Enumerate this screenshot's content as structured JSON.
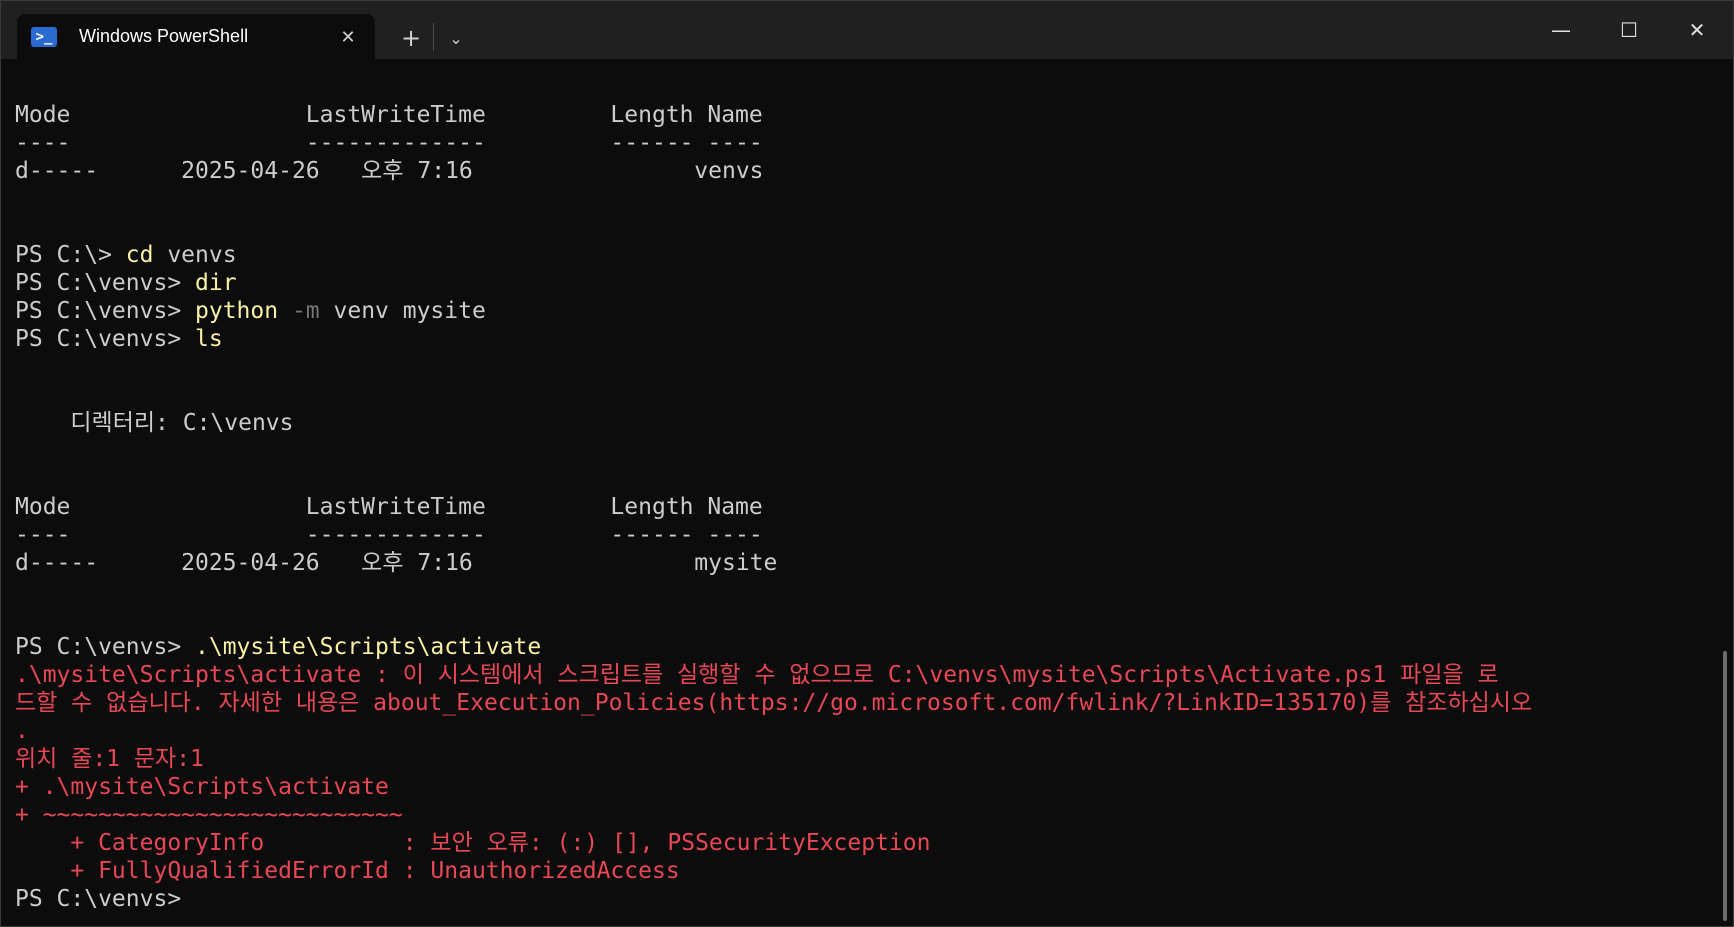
{
  "window": {
    "tab_title": "Windows PowerShell",
    "tab_icon": "powershell-icon",
    "tab_icon_glyph": ">_",
    "close_tab_glyph": "✕",
    "add_tab_glyph": "+",
    "dropdown_glyph": "⌄",
    "minimize_glyph": "—",
    "maximize_glyph": "☐",
    "close_glyph": "✕"
  },
  "colors": {
    "background": "#0c0c0c",
    "text": "#cccccc",
    "command": "#f9f1a5",
    "parameter": "#767676",
    "error": "#e74856"
  },
  "terminal": {
    "table1": {
      "header": "Mode                 LastWriteTime         Length Name",
      "divider": "----                 -------------         ------ ----",
      "row": "d-----      2025-04-26   오후 7:16                venvs"
    },
    "commands": [
      {
        "prompt": "PS C:\\> ",
        "cmd": "cd",
        "param": "",
        "args": " venvs"
      },
      {
        "prompt": "PS C:\\venvs> ",
        "cmd": "dir",
        "param": "",
        "args": ""
      },
      {
        "prompt": "PS C:\\venvs> ",
        "cmd": "python",
        "param": " -m",
        "args": " venv mysite"
      },
      {
        "prompt": "PS C:\\venvs> ",
        "cmd": "ls",
        "param": "",
        "args": ""
      }
    ],
    "directory_line": "    디렉터리: C:\\venvs",
    "table2": {
      "header": "Mode                 LastWriteTime         Length Name",
      "divider": "----                 -------------         ------ ----",
      "row": "d-----      2025-04-26   오후 7:16                mysite"
    },
    "activate": {
      "prompt": "PS C:\\venvs> ",
      "cmd": ".\\mysite\\Scripts\\activate"
    },
    "error_lines": [
      ".\\mysite\\Scripts\\activate : 이 시스템에서 스크립트를 실행할 수 없으므로 C:\\venvs\\mysite\\Scripts\\Activate.ps1 파일을 로",
      "드할 수 없습니다. 자세한 내용은 about_Execution_Policies(https://go.microsoft.com/fwlink/?LinkID=135170)를 참조하십시오",
      ".",
      "위치 줄:1 문자:1",
      "+ .\\mysite\\Scripts\\activate",
      "+ ~~~~~~~~~~~~~~~~~~~~~~~~~~",
      "    + CategoryInfo          : 보안 오류: (:) [], PSSecurityException",
      "    + FullyQualifiedErrorId : UnauthorizedAccess"
    ],
    "final_prompt": "PS C:\\venvs>"
  }
}
